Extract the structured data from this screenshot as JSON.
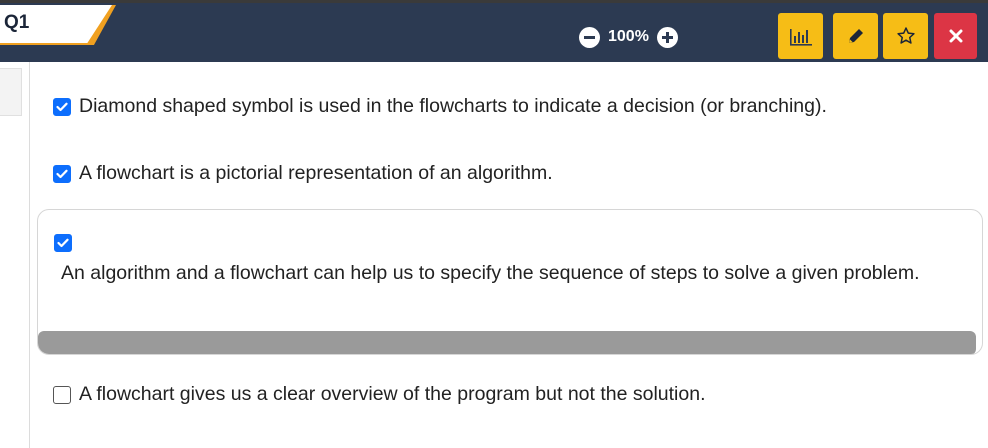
{
  "header": {
    "question_label": "Q1",
    "zoom": {
      "value": "100%",
      "decrease_icon": "minus-circle-icon",
      "increase_icon": "plus-circle-icon"
    },
    "tools": [
      {
        "name": "chart",
        "icon": "bar-chart-icon",
        "color": "#f6bd16"
      },
      {
        "name": "edit",
        "icon": "pencil-icon",
        "color": "#f6bd16"
      },
      {
        "name": "favorite",
        "icon": "star-icon",
        "color": "#f6bd16"
      },
      {
        "name": "close",
        "icon": "close-icon",
        "color": "#dc3545"
      }
    ],
    "colors": {
      "bar": "#2c3a52",
      "tab_accent": "#f0a020"
    }
  },
  "options": [
    {
      "checked": true,
      "text": "Diamond shaped symbol is used in the flowcharts to indicate a decision (or branching)."
    },
    {
      "checked": true,
      "text": "A flowchart is a pictorial representation of an algorithm."
    },
    {
      "checked": true,
      "text": "An algorithm and a flowchart can help us to specify the sequence of steps to solve a given problem."
    },
    {
      "checked": false,
      "text": "A flowchart gives us a clear overview of the program but not the solution."
    }
  ],
  "accent_color": "#0d6efd"
}
